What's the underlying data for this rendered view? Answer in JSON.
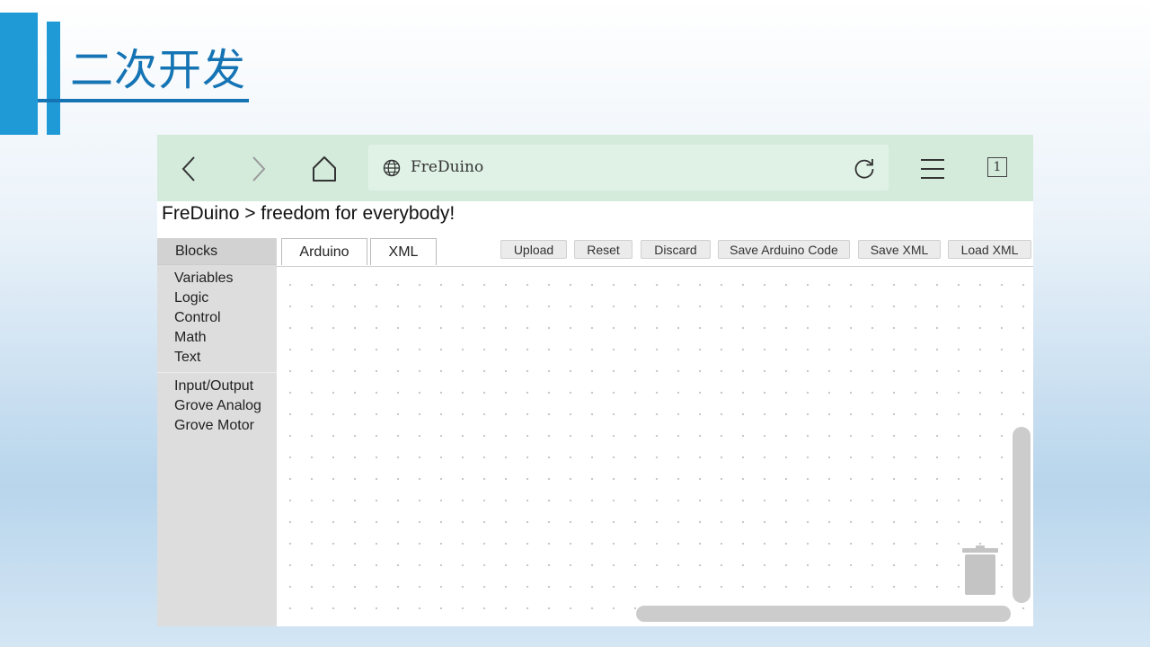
{
  "slide": {
    "title": "二次开发"
  },
  "browser": {
    "url_text": "FreDuino",
    "tab_count": "1"
  },
  "page": {
    "heading": "FreDuino > freedom for everybody!",
    "sidebar": {
      "header": "Blocks",
      "categories": [
        "Variables",
        "Logic",
        "Control",
        "Math",
        "Text"
      ],
      "categories2": [
        "Input/Output",
        "Grove Analog",
        "Grove Motor"
      ]
    },
    "tabs": [
      "Arduino",
      "XML"
    ],
    "buttons": [
      "Upload",
      "Reset",
      "Discard",
      "Save Arduino Code",
      "Save XML",
      "Load XML"
    ]
  },
  "icons": {
    "back": "chevron-left-icon",
    "forward": "chevron-right-icon",
    "home": "home-icon",
    "globe": "globe-icon",
    "reload": "reload-icon",
    "menu": "hamburger-menu-icon",
    "trash": "trash-icon"
  },
  "colors": {
    "accent": "#1f9ad6",
    "title": "#1574b4",
    "toolbar": "#d4ebdc",
    "sidebar": "#dddddd"
  }
}
